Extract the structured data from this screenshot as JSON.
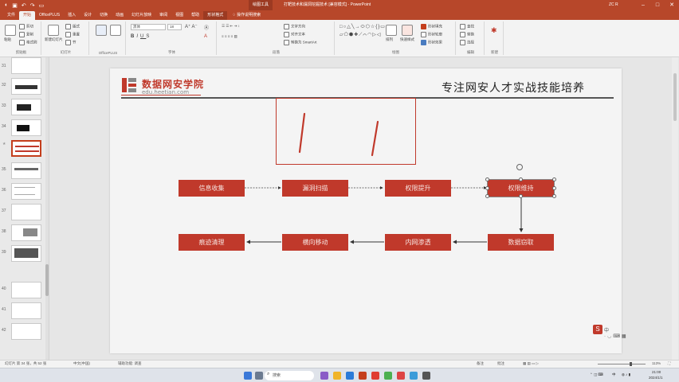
{
  "titlebar": {
    "context_tab": "绘图工具",
    "doc_title": "打靶技术和漏洞挖掘技术 [兼容模式] - PowerPoint",
    "user": "ZC R",
    "min": "–",
    "max": "□",
    "close": "✕"
  },
  "tabs": {
    "items": [
      "文件",
      "开始",
      "OfficePLUS",
      "插入",
      "设计",
      "切换",
      "动画",
      "幻灯片放映",
      "审阅",
      "视图",
      "帮助",
      "形状格式"
    ],
    "tell": "操作说明搜索"
  },
  "ribbon": {
    "clipboard": {
      "paste": "粘贴",
      "cut": "剪切",
      "copy": "复制",
      "format_painter": "格式刷",
      "label": "剪贴板"
    },
    "slides": {
      "new_slide": "新建幻灯片",
      "layout": "版式",
      "reset": "重置",
      "section": "节",
      "label": "幻灯片"
    },
    "officeplus": {
      "label": "OfficePLUS"
    },
    "font": {
      "name": "黑体",
      "size": "18",
      "label": "字体"
    },
    "paragraph": {
      "text_direction": "文字方向",
      "align_text": "对齐文本",
      "smartart": "转换为 SmartArt",
      "label": "段落"
    },
    "drawing": {
      "arrange": "排列",
      "quick_styles": "快速样式",
      "fill": "形状填充",
      "outline": "形状轮廓",
      "effect": "形状效果",
      "label": "绘图"
    },
    "editing": {
      "find": "查找",
      "replace": "替换",
      "select": "选择",
      "label": "编辑"
    },
    "new_group": {
      "label": "新建"
    }
  },
  "thumbs": {
    "numbers": [
      "31",
      "32",
      "33",
      "34",
      "35",
      "36",
      "37",
      "38",
      "39",
      "40",
      "41",
      "42"
    ]
  },
  "slide": {
    "logo_cn": "数据网安学院",
    "logo_en": "edu.heetian.com",
    "slogan": "专注网安人才实战技能培养",
    "boxes_row1": [
      "信息收集",
      "漏洞扫描",
      "权限提升",
      "权限维持"
    ],
    "boxes_row2": [
      "痕迹清理",
      "横向移动",
      "内网渗透",
      "数据窃取"
    ]
  },
  "status": {
    "slide_pos": "幻灯片 第 34 张，共 52 张",
    "lang": "中文(中国)",
    "accessibility": "辅助功能: 调查",
    "notes": "备注",
    "comments": "批注",
    "zoom": "113%"
  },
  "taskbar": {
    "search": "搜索",
    "time": "21:00",
    "date": "2024/1/1",
    "lang": "中"
  },
  "colors": {
    "accent": "#b7472a",
    "box_red": "#c0392b"
  }
}
